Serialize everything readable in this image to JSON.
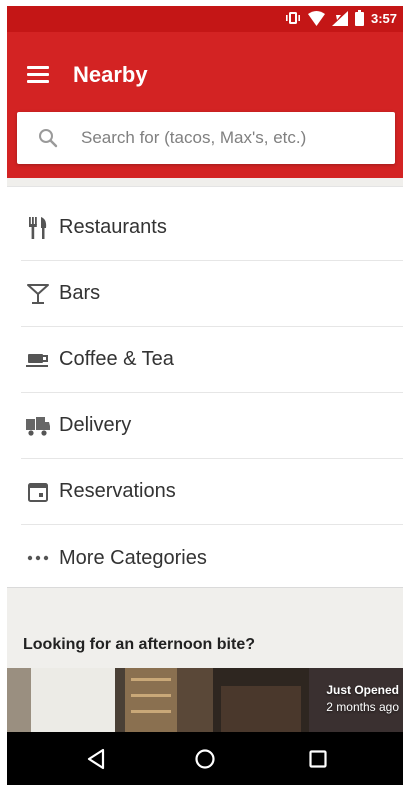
{
  "status_bar": {
    "time": "3:57",
    "icons": [
      "vibrate-icon",
      "wifi-icon",
      "cellular-signal-icon",
      "battery-icon"
    ]
  },
  "app_bar": {
    "title": "Nearby",
    "menu_icon": "hamburger-menu-icon"
  },
  "search": {
    "placeholder": "Search for (tacos, Max's, etc.)",
    "value": "",
    "icon": "search-icon"
  },
  "categories": [
    {
      "label": "Restaurants",
      "icon": "fork-knife-icon"
    },
    {
      "label": "Bars",
      "icon": "cocktail-glass-icon"
    },
    {
      "label": "Coffee & Tea",
      "icon": "coffee-cup-icon"
    },
    {
      "label": "Delivery",
      "icon": "delivery-truck-icon"
    },
    {
      "label": "Reservations",
      "icon": "calendar-icon"
    },
    {
      "label": "More Categories",
      "icon": "more-dots-icon"
    }
  ],
  "section": {
    "heading": "Looking for an afternoon bite?"
  },
  "promo": {
    "badge_title": "Just Opened",
    "badge_subtitle": "2 months ago"
  },
  "nav_bar": {
    "buttons": [
      "back-icon",
      "home-icon",
      "recents-icon"
    ]
  },
  "colors": {
    "brand_red": "#d32323",
    "status_red": "#c41616",
    "background": "#f0efec",
    "text": "#333333",
    "placeholder": "#808080"
  }
}
